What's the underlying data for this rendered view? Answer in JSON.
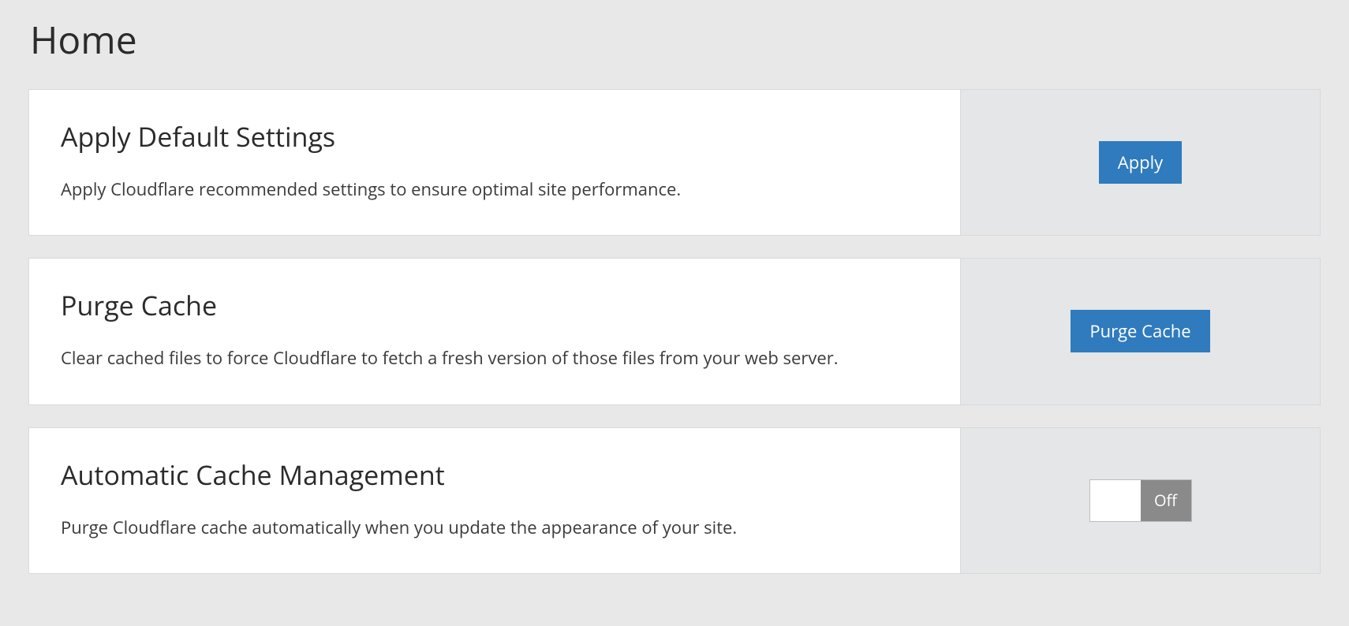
{
  "page": {
    "title": "Home"
  },
  "cards": {
    "apply_default": {
      "title": "Apply Default Settings",
      "desc": "Apply Cloudflare recommended settings to ensure optimal site performance.",
      "button_label": "Apply"
    },
    "purge_cache": {
      "title": "Purge Cache",
      "desc": "Clear cached files to force Cloudflare to fetch a fresh version of those files from your web server.",
      "button_label": "Purge Cache"
    },
    "auto_cache": {
      "title": "Automatic Cache Management",
      "desc": "Purge Cloudflare cache automatically when you update the appearance of your site.",
      "toggle_state": "Off"
    }
  }
}
